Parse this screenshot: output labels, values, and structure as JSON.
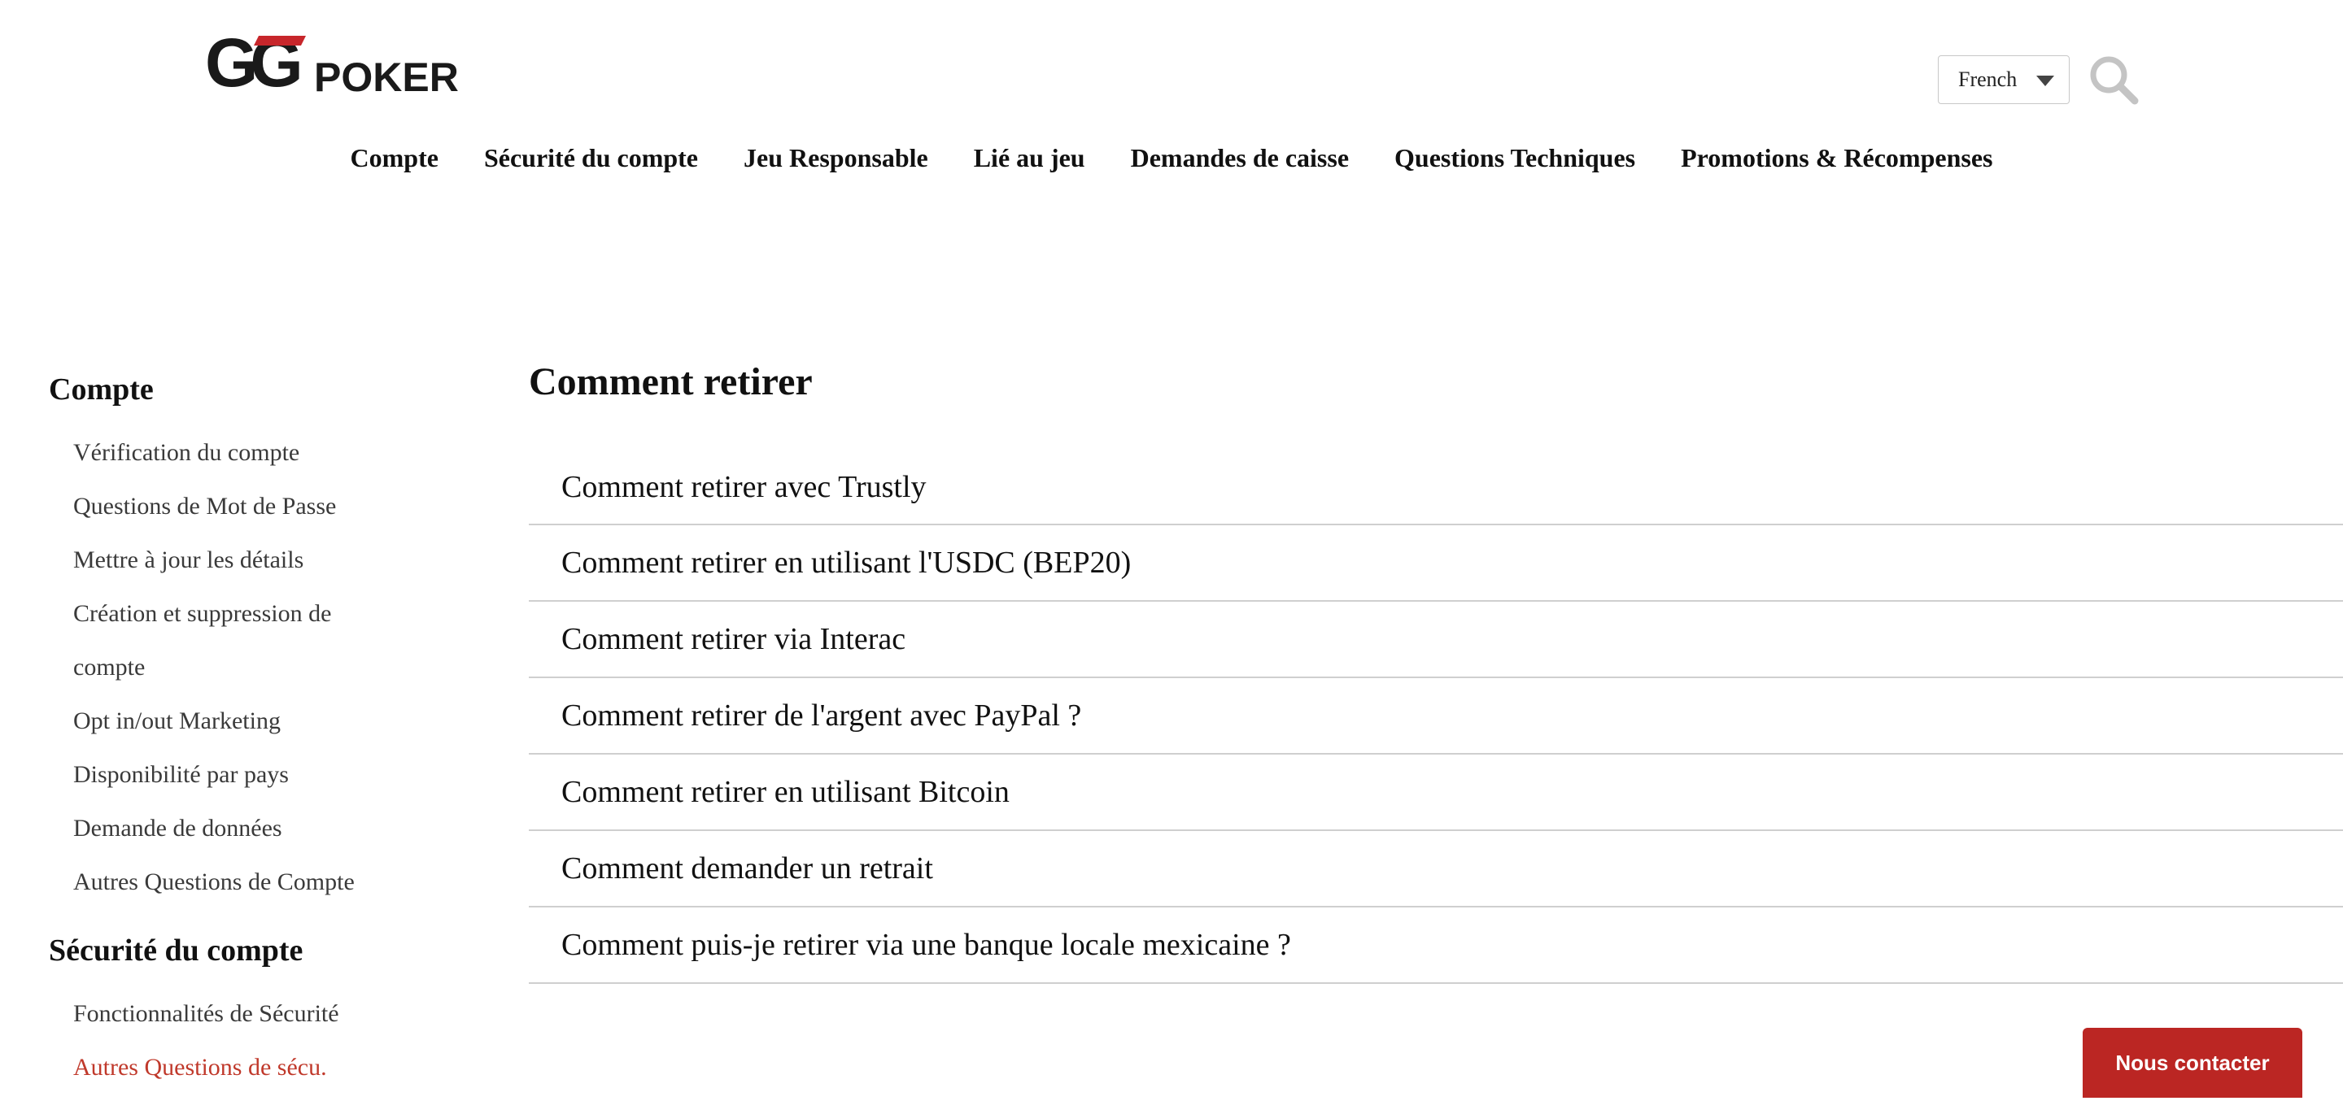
{
  "header": {
    "logo_text": "GGPOKER",
    "language": "French",
    "colors": {
      "logo_dark": "#1a1a1a",
      "logo_red": "#c7262b"
    }
  },
  "topnav": {
    "items": [
      "Compte",
      "Sécurité du compte",
      "Jeu Responsable",
      "Lié au jeu",
      "Demandes de caisse",
      "Questions Techniques",
      "Promotions & Récompenses"
    ]
  },
  "sidebar": {
    "sections": [
      {
        "heading": "Compte",
        "items": [
          "Vérification du compte",
          "Questions de Mot de Passe",
          "Mettre à jour les détails",
          "Création et suppression de",
          "compte",
          "Opt in/out Marketing",
          "Disponibilité par pays",
          "Demande de données",
          "Autres Questions de Compte"
        ]
      },
      {
        "heading": "Sécurité du compte",
        "items": [
          "Fonctionnalités de Sécurité",
          "Autres Questions de sécu."
        ]
      }
    ]
  },
  "main": {
    "title": "Comment retirer",
    "articles": [
      "Comment retirer avec Trustly",
      "Comment retirer en utilisant l'USDC (BEP20)",
      "Comment retirer via Interac",
      "Comment retirer de l'argent avec PayPal ?",
      "Comment retirer en utilisant Bitcoin",
      "Comment demander un retrait",
      "Comment puis-je retirer via une banque locale mexicaine ?"
    ]
  },
  "contact_button": {
    "label": "Nous contacter",
    "color": "#bb2623"
  }
}
